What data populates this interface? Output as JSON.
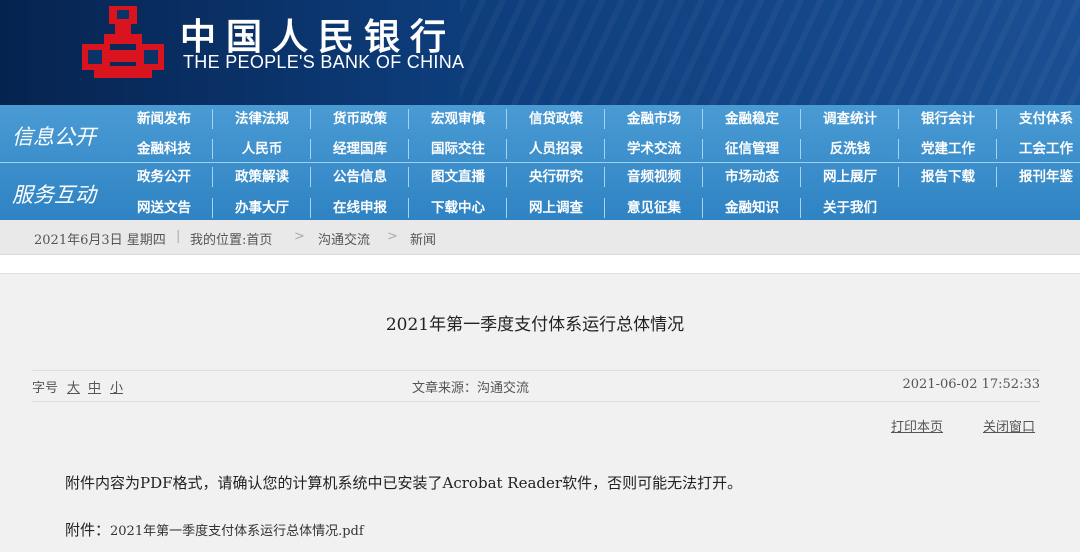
{
  "header": {
    "bank_name_cn": "中国人民银行",
    "bank_name_en": "THE PEOPLE'S BANK OF CHINA",
    "logo_color": "#d9141e"
  },
  "nav": {
    "category_info": "信息公开",
    "category_service": "服务互动",
    "row1": [
      "新闻发布",
      "法律法规",
      "货币政策",
      "宏观审慎",
      "信贷政策",
      "金融市场",
      "金融稳定",
      "调查统计",
      "银行会计",
      "支付体系"
    ],
    "row2": [
      "金融科技",
      "人民币",
      "经理国库",
      "国际交往",
      "人员招录",
      "学术交流",
      "征信管理",
      "反洗钱",
      "党建工作",
      "工会工作"
    ],
    "row3": [
      "政务公开",
      "政策解读",
      "公告信息",
      "图文直播",
      "央行研究",
      "音频视频",
      "市场动态",
      "网上展厅",
      "报告下载",
      "报刊年鉴"
    ],
    "row4": [
      "网送文告",
      "办事大厅",
      "在线申报",
      "下载中心",
      "网上调查",
      "意见征集",
      "金融知识",
      "关于我们"
    ]
  },
  "breadcrumb": {
    "date": "2021年6月3日  星期四",
    "location_label": "我的位置:首页",
    "level1": "沟通交流",
    "level2": "新闻",
    "separator": ">"
  },
  "article": {
    "title": "2021年第一季度支付体系运行总体情况",
    "font_size_label": "字号",
    "size_large": "大",
    "size_medium": "中",
    "size_small": "小",
    "source": "文章来源：沟通交流",
    "datetime": "2021-06-02 17:52:33",
    "print_label": "打印本页",
    "close_label": "关闭窗口",
    "notice": "附件内容为PDF格式，请确认您的计算机系统中已安装了Acrobat Reader软件，否则可能无法打开。",
    "attachment_label": "附件：",
    "attachment_file": "2021年第一季度支付体系运行总体情况.pdf"
  }
}
